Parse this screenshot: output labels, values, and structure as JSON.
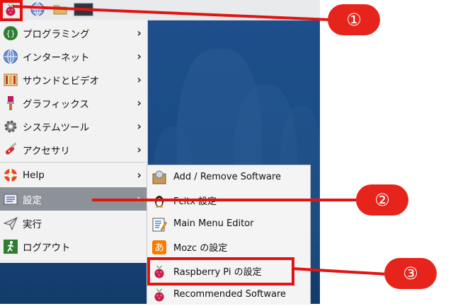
{
  "menu": {
    "items": [
      {
        "label": "プログラミング",
        "icon": "programming-icon"
      },
      {
        "label": "インターネット",
        "icon": "globe-icon"
      },
      {
        "label": "サウンドとビデオ",
        "icon": "sound-video-icon"
      },
      {
        "label": "グラフィックス",
        "icon": "paintbrush-icon"
      },
      {
        "label": "システムツール",
        "icon": "gear-icon"
      },
      {
        "label": "アクセサリ",
        "icon": "swiss-knife-icon"
      },
      {
        "label": "Help",
        "icon": "lifebuoy-icon"
      },
      {
        "label": "設定",
        "icon": "settings-panel-icon"
      },
      {
        "label": "実行",
        "icon": "paper-plane-icon"
      },
      {
        "label": "ログアウト",
        "icon": "exit-icon"
      }
    ],
    "submenu_arrow": "›"
  },
  "submenu": {
    "items": [
      {
        "label": "Add / Remove Software",
        "icon": "package-icon"
      },
      {
        "label": "Fcitx 設定",
        "icon": "penguin-icon"
      },
      {
        "label": "Main Menu Editor",
        "icon": "menu-editor-icon"
      },
      {
        "label": "Mozc の設定",
        "icon": "mozc-icon"
      },
      {
        "label": "Raspberry Pi の設定",
        "icon": "raspberry-icon"
      },
      {
        "label": "Recommended Software",
        "icon": "raspberry-icon"
      }
    ]
  },
  "callouts": [
    "①",
    "②",
    "③"
  ],
  "colors": {
    "highlight": "#e11414",
    "selected": "#8d9299",
    "desktop": "#1b4d87"
  }
}
